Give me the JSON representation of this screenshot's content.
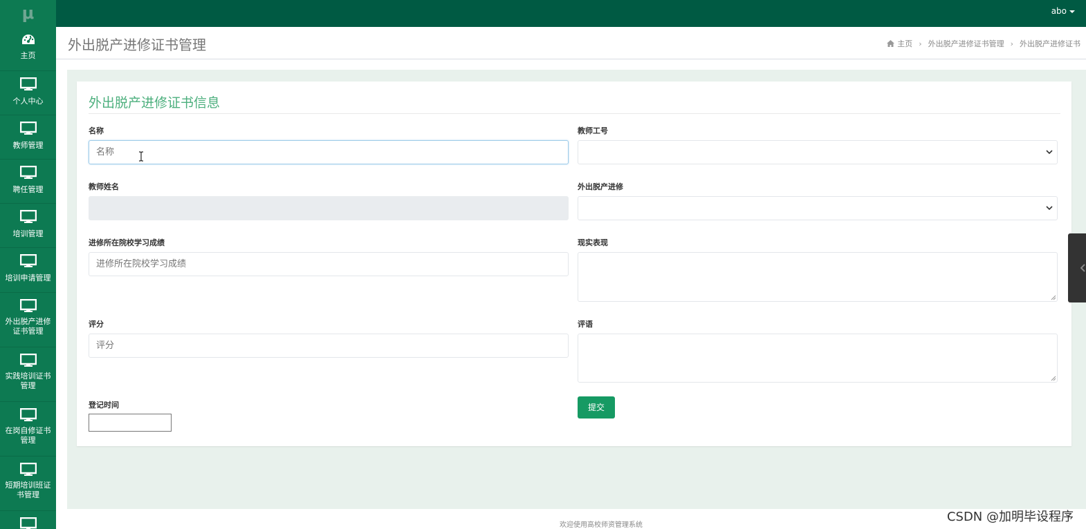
{
  "app": {
    "logo": "μ",
    "user": "abo"
  },
  "sidebar": {
    "items": [
      {
        "label": "主页",
        "icon": "dashboard-icon"
      },
      {
        "label": "个人中心",
        "icon": "monitor-icon"
      },
      {
        "label": "教师管理",
        "icon": "monitor-icon"
      },
      {
        "label": "聘任管理",
        "icon": "monitor-icon"
      },
      {
        "label": "培训管理",
        "icon": "monitor-icon"
      },
      {
        "label": "培训申请管理",
        "icon": "monitor-icon"
      },
      {
        "label": "外出脱产进修证书管理",
        "icon": "monitor-icon"
      },
      {
        "label": "实践培训证书管理",
        "icon": "monitor-icon"
      },
      {
        "label": "在岗自修证书管理",
        "icon": "monitor-icon"
      },
      {
        "label": "短期培训班证书管理",
        "icon": "monitor-icon"
      },
      {
        "label": "",
        "icon": "monitor-icon"
      }
    ]
  },
  "header": {
    "title": "外出脱产进修证书管理",
    "breadcrumb": [
      "主页",
      "外出脱产进修证书管理",
      "外出脱产进修证书"
    ]
  },
  "form": {
    "title": "外出脱产进修证书信息",
    "name_label": "名称",
    "name_placeholder": "名称",
    "teacher_id_label": "教师工号",
    "teacher_name_label": "教师姓名",
    "training_label": "外出脱产进修",
    "score_school_label": "进修所在院校学习成绩",
    "score_school_placeholder": "进修所在院校学习成绩",
    "performance_label": "现实表现",
    "rating_label": "评分",
    "rating_placeholder": "评分",
    "comment_label": "评语",
    "date_label": "登记时间",
    "submit_label": "提交"
  },
  "footer": {
    "text": "欢迎使用高校师资管理系统"
  },
  "watermark": "CSDN @加明毕设程序"
}
